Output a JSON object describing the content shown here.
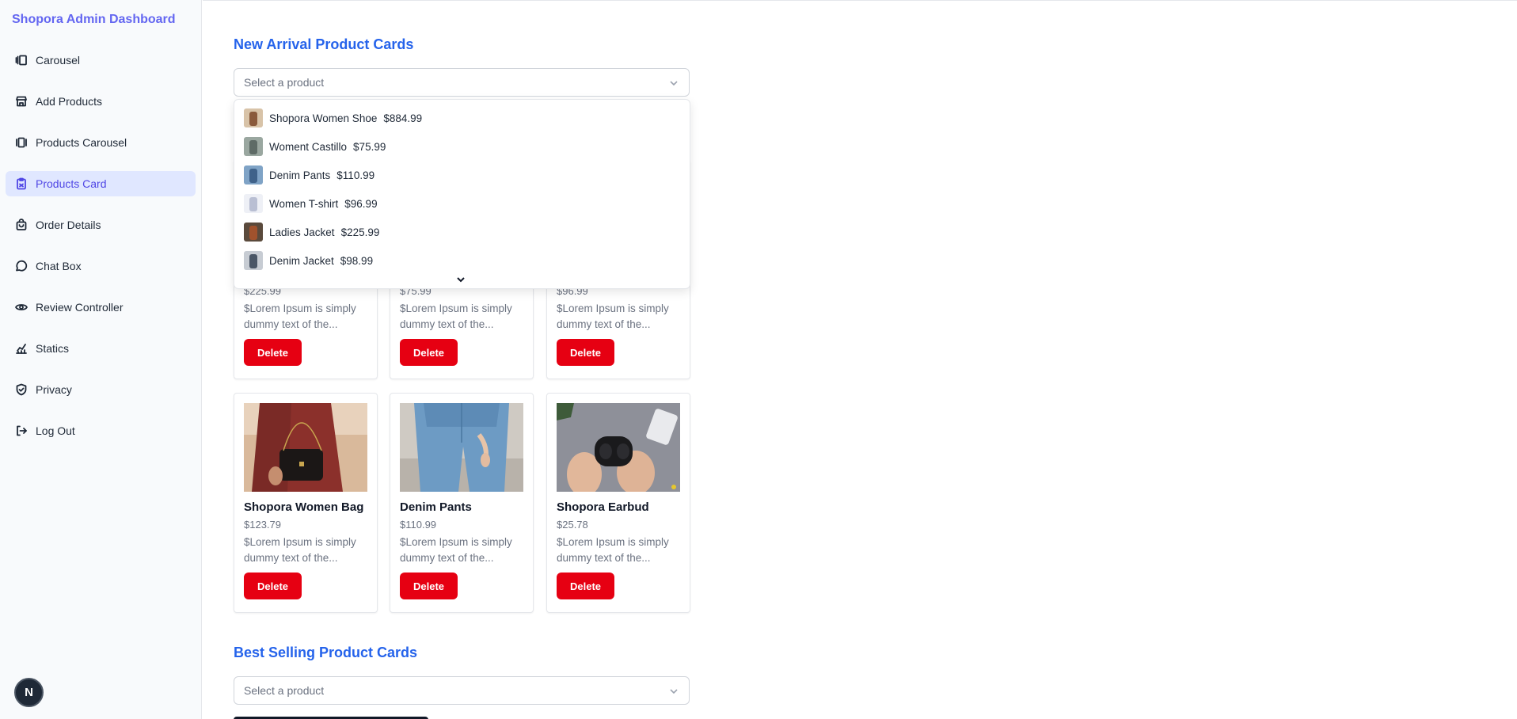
{
  "sidebar": {
    "brand": "Shopora Admin Dashboard",
    "items": [
      {
        "label": "Carousel",
        "icon": "carousel-icon"
      },
      {
        "label": "Add Products",
        "icon": "store-icon"
      },
      {
        "label": "Products Carousel",
        "icon": "gallery-icon"
      },
      {
        "label": "Products Card",
        "icon": "clipboard-icon",
        "active": true
      },
      {
        "label": "Order Details",
        "icon": "shopping-bag-icon"
      },
      {
        "label": "Chat Box",
        "icon": "chat-icon"
      },
      {
        "label": "Review Controller",
        "icon": "eye-icon"
      },
      {
        "label": "Statics",
        "icon": "chart-icon"
      },
      {
        "label": "Privacy",
        "icon": "shield-icon"
      },
      {
        "label": "Log Out",
        "icon": "logout-icon"
      }
    ],
    "badge": "N"
  },
  "new_arrival": {
    "title": "New Arrival Product Cards",
    "select_placeholder": "Select a product",
    "cards_row1": [
      {
        "price": "$225.99",
        "desc": "$Lorem Ipsum is simply dummy text of the...",
        "delete": "Delete"
      },
      {
        "price": "$75.99",
        "desc": "$Lorem Ipsum is simply dummy text of the...",
        "delete": "Delete"
      },
      {
        "price": "$96.99",
        "desc": "$Lorem Ipsum is simply dummy text of the...",
        "delete": "Delete"
      }
    ],
    "cards_row2": [
      {
        "name": "Shopora Women Bag",
        "price": "$123.79",
        "desc": "$Lorem Ipsum is simply dummy text of the...",
        "delete": "Delete"
      },
      {
        "name": "Denim Pants",
        "price": "$110.99",
        "desc": "$Lorem Ipsum is simply dummy text of the...",
        "delete": "Delete"
      },
      {
        "name": "Shopora Earbud",
        "price": "$25.78",
        "desc": "$Lorem Ipsum is simply dummy text of the...",
        "delete": "Delete"
      }
    ]
  },
  "dropdown": {
    "options": [
      {
        "name": "Shopora Women Shoe",
        "price": "$884.99"
      },
      {
        "name": "Woment Castillo",
        "price": "$75.99"
      },
      {
        "name": "Denim Pants",
        "price": "$110.99"
      },
      {
        "name": "Women T-shirt",
        "price": "$96.99"
      },
      {
        "name": "Ladies Jacket",
        "price": "$225.99"
      },
      {
        "name": "Denim Jacket",
        "price": "$98.99"
      }
    ]
  },
  "best_selling": {
    "title": "Best Selling Product Cards",
    "select_placeholder": "Select a product"
  },
  "colors": {
    "brand": "#6366f1",
    "section_title": "#2563eb",
    "delete": "#e60012",
    "active_bg": "#e0e7ff"
  }
}
